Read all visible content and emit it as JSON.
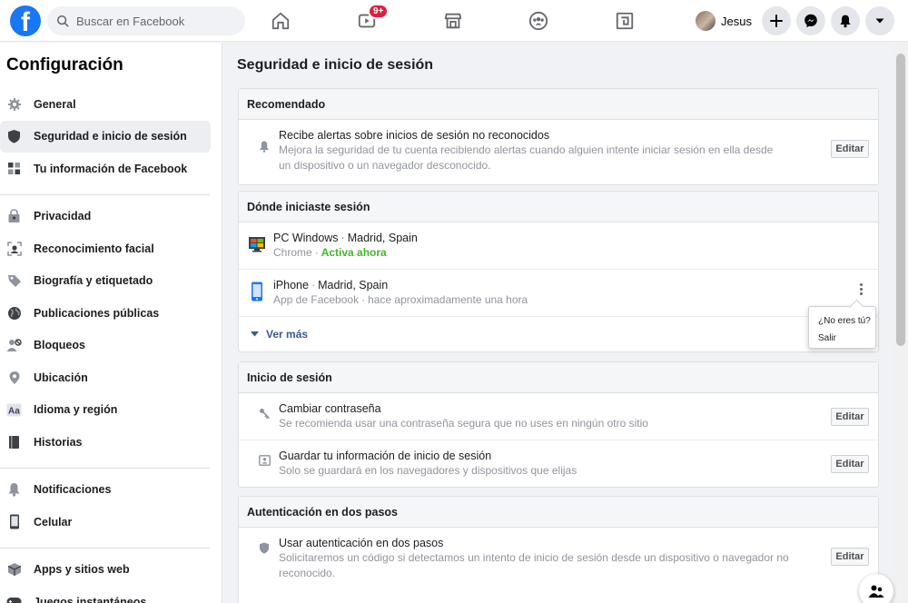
{
  "topbar": {
    "logo": "f",
    "search_placeholder": "Buscar en Facebook",
    "watch_badge": "9+",
    "user_name": "Jesus",
    "icons": [
      "home-icon",
      "watch-icon",
      "marketplace-icon",
      "groups-icon",
      "gaming-icon",
      "plus-icon",
      "messenger-icon",
      "notifications-icon",
      "chevron-down-icon"
    ]
  },
  "sidebar": {
    "title": "Configuración",
    "groups": [
      {
        "items": [
          {
            "label": "General",
            "icon": "gear-icon"
          },
          {
            "label": "Seguridad e inicio de sesión",
            "icon": "shield-icon",
            "active": true
          },
          {
            "label": "Tu información de Facebook",
            "icon": "info-grid-icon"
          }
        ]
      },
      {
        "items": [
          {
            "label": "Privacidad",
            "icon": "lock-person-icon"
          },
          {
            "label": "Reconocimiento facial",
            "icon": "face-icon"
          },
          {
            "label": "Biografía y etiquetado",
            "icon": "tag-icon"
          },
          {
            "label": "Publicaciones públicas",
            "icon": "globe-icon"
          },
          {
            "label": "Bloqueos",
            "icon": "block-user-icon"
          },
          {
            "label": "Ubicación",
            "icon": "location-icon"
          },
          {
            "label": "Idioma y región",
            "icon": "language-icon"
          },
          {
            "label": "Historias",
            "icon": "book-icon"
          }
        ]
      },
      {
        "items": [
          {
            "label": "Notificaciones",
            "icon": "bell-icon"
          },
          {
            "label": "Celular",
            "icon": "phone-icon"
          }
        ]
      },
      {
        "items": [
          {
            "label": "Apps y sitios web",
            "icon": "cube-icon"
          },
          {
            "label": "Juegos instantáneos",
            "icon": "gamepad-icon"
          }
        ]
      }
    ]
  },
  "main": {
    "title": "Seguridad e inicio de sesión",
    "recommended": {
      "header": "Recomendado",
      "title": "Recibe alertas sobre inicios de sesión no reconocidos",
      "desc": "Mejora la seguridad de tu cuenta recibiendo alertas cuando alguien intente iniciar sesión en ella desde un dispositivo o un navegador desconocido.",
      "button": "Editar"
    },
    "where": {
      "header": "Dónde iniciaste sesión",
      "devices": [
        {
          "name": "PC Windows",
          "location": "Madrid, Spain",
          "app": "Chrome",
          "status": "Activa ahora",
          "icon": "windows-pc-icon"
        },
        {
          "name": "iPhone",
          "location": "Madrid, Spain",
          "app": "App de Facebook",
          "status": "hace aproximadamente una hora",
          "icon": "iphone-icon"
        }
      ],
      "more": "Ver más",
      "popover": [
        "¿No eres tú?",
        "Salir"
      ]
    },
    "login": {
      "header": "Inicio de sesión",
      "rows": [
        {
          "title": "Cambiar contraseña",
          "desc": "Se recomienda usar una contraseña segura que no uses en ningún otro sitio",
          "button": "Editar"
        },
        {
          "title": "Guardar tu información de inicio de sesión",
          "desc": "Solo se guardará en los navegadores y dispositivos que elijas",
          "button": "Editar"
        }
      ]
    },
    "twofa": {
      "header": "Autenticación en dos pasos",
      "rows": [
        {
          "title": "Usar autenticación en dos pasos",
          "desc": "Solicitaremos un código si detectamos un intento de inicio de sesión desde un dispositivo o navegador no reconocido.",
          "button": "Editar"
        }
      ]
    }
  },
  "colors": {
    "brand": "#1877f2",
    "badge": "#e41e3f",
    "active": "#42b72a",
    "link": "#385898"
  }
}
